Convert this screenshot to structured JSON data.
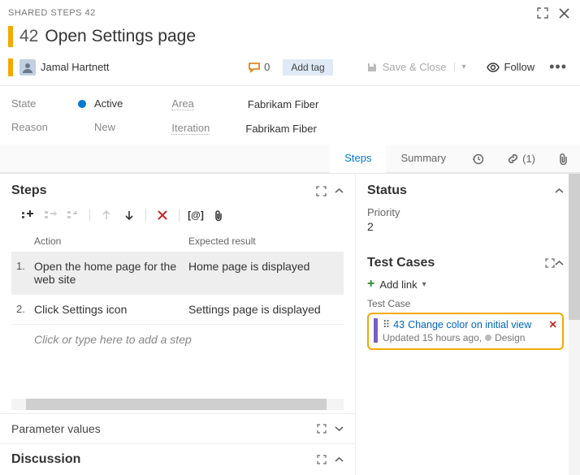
{
  "titlebar": {
    "label": "SHARED STEPS 42"
  },
  "workitem": {
    "id": "42",
    "title": "Open Settings page"
  },
  "assignee": {
    "name": "Jamal Hartnett"
  },
  "discussion_count": "0",
  "addtag_label": "Add tag",
  "save_label": "Save & Close",
  "follow_label": "Follow",
  "fields": {
    "state_label": "State",
    "state_value": "Active",
    "reason_label": "Reason",
    "reason_value": "New",
    "area_label": "Area",
    "area_value": "Fabrikam Fiber",
    "iteration_label": "Iteration",
    "iteration_value": "Fabrikam Fiber"
  },
  "tabs": {
    "steps": "Steps",
    "summary": "Summary",
    "links_count": "(1)"
  },
  "steps_section": {
    "heading": "Steps",
    "col_action": "Action",
    "col_expected": "Expected result",
    "rows": [
      {
        "num": "1.",
        "action": "Open the home page for the web site",
        "expected": "Home page is displayed"
      },
      {
        "num": "2.",
        "action": "Click Settings icon",
        "expected": "Settings page is displayed"
      }
    ],
    "placeholder": "Click or type here to add a step"
  },
  "param_label": "Parameter values",
  "discussion_heading": "Discussion",
  "right": {
    "status_heading": "Status",
    "priority_label": "Priority",
    "priority_value": "2",
    "testcases_heading": "Test Cases",
    "addlink_label": "Add link",
    "tc_group_label": "Test Case",
    "linked": {
      "id": "43",
      "title": "Change color on initial view",
      "updated": "Updated 15 hours ago,",
      "state": "Design"
    }
  }
}
